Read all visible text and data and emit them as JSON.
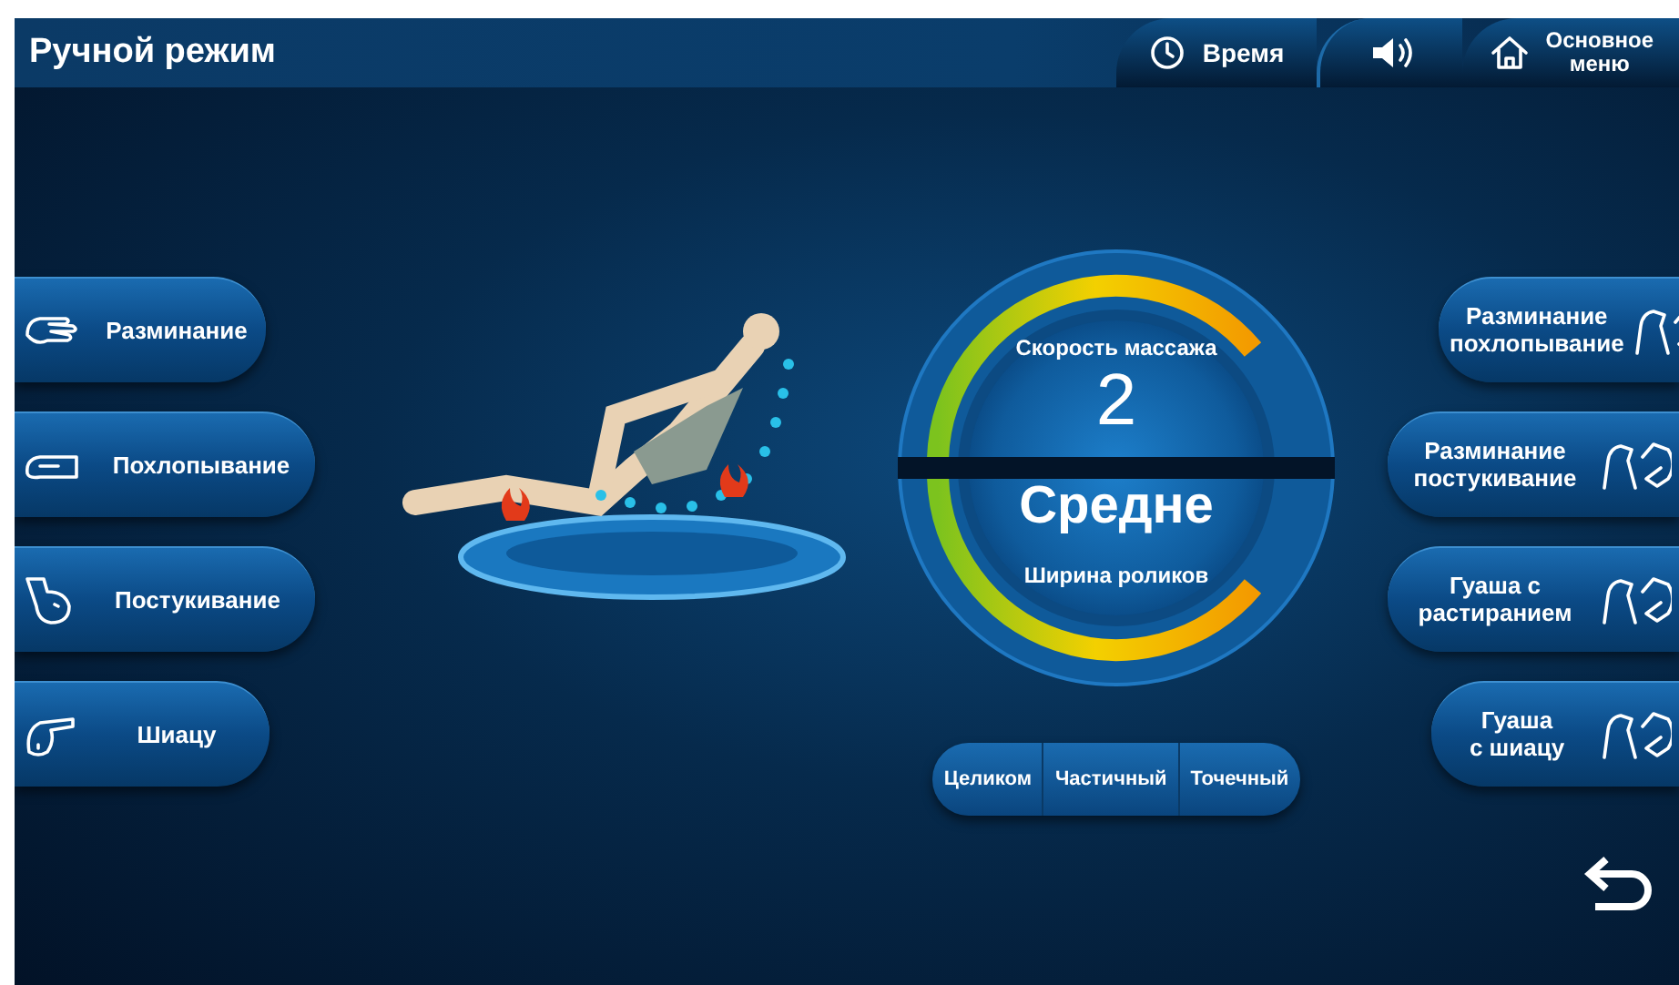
{
  "header": {
    "title": "Ручной режим",
    "items": [
      {
        "kind": "time",
        "label": "Время"
      },
      {
        "kind": "sound"
      },
      {
        "kind": "home",
        "label": "Основное\nменю"
      }
    ]
  },
  "left_buttons": [
    {
      "kind": "knead",
      "label": "Разминание"
    },
    {
      "kind": "tap",
      "label": "Похлопывание"
    },
    {
      "kind": "knock",
      "label": "Постукивание"
    },
    {
      "kind": "shiatsu",
      "label": "Шиацу"
    }
  ],
  "gauge": {
    "speed_label": "Скорость массажа",
    "speed_value": "2",
    "width_value": "Средне",
    "width_label": "Ширина роликов"
  },
  "modes": [
    "Целиком",
    "Частичный",
    "Точечный"
  ],
  "right_buttons": [
    {
      "label": "Разминание\nпохлопывание"
    },
    {
      "label": "Разминание\nпостукивание"
    },
    {
      "label": "Гуаша с\nрастиранием"
    },
    {
      "label": "Гуаша\nс шиацу"
    }
  ]
}
